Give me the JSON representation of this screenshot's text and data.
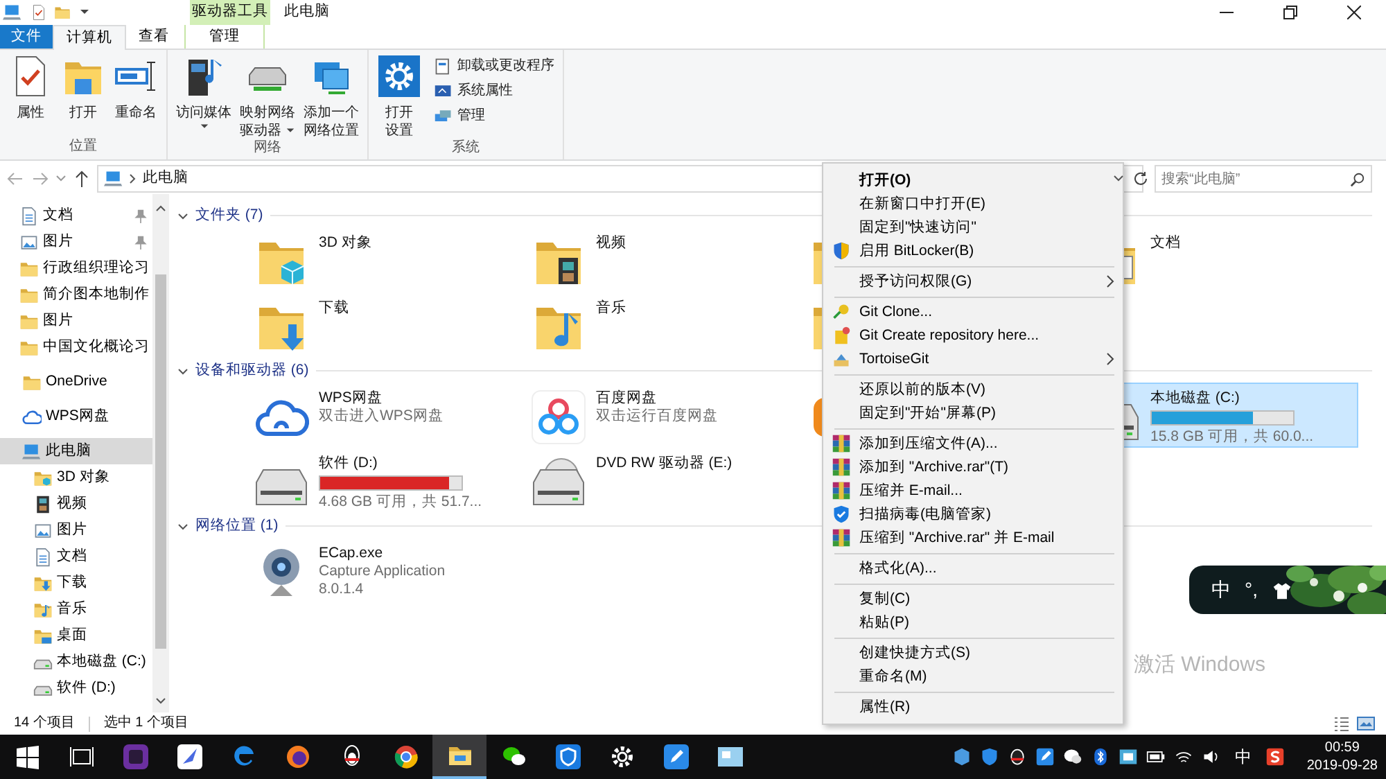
{
  "window": {
    "title": "此电脑",
    "tool_tab": "驱动器工具"
  },
  "ribbon": {
    "tabs": [
      {
        "label": "文件",
        "kind": "file",
        "selected": false
      },
      {
        "label": "计算机",
        "kind": "tab",
        "selected": true
      },
      {
        "label": "查看",
        "kind": "tab",
        "selected": false
      },
      {
        "label": "管理",
        "kind": "tool",
        "selected": false
      }
    ],
    "groups": [
      {
        "label": "位置",
        "buttons": [
          {
            "lines": [
              "属性"
            ],
            "kind": "properties",
            "dropdown": false
          },
          {
            "lines": [
              "打开"
            ],
            "kind": "open",
            "dropdown": false
          },
          {
            "lines": [
              "重命名"
            ],
            "kind": "rename",
            "dropdown": false
          }
        ]
      },
      {
        "label": "网络",
        "buttons": [
          {
            "lines": [
              "访问媒体"
            ],
            "kind": "media",
            "dropdown": true
          },
          {
            "lines": [
              "映射网络",
              "驱动器"
            ],
            "kind": "map-drive",
            "dropdown": true
          },
          {
            "lines": [
              "添加一个",
              "网络位置"
            ],
            "kind": "add-location",
            "dropdown": false
          }
        ]
      },
      {
        "label": "系统",
        "buttons": [
          {
            "lines": [
              "打开",
              "设置"
            ],
            "kind": "settings",
            "dropdown": false
          }
        ],
        "small_buttons": [
          {
            "label": "卸载或更改程序",
            "kind": "uninstall"
          },
          {
            "label": "系统属性",
            "kind": "sys-props"
          },
          {
            "label": "管理",
            "kind": "manage"
          }
        ]
      }
    ]
  },
  "address_bar": {
    "path": "此电脑",
    "search_placeholder": "搜索“此电脑”"
  },
  "navigation": {
    "quick_access": [
      {
        "label": "文档",
        "kind": "doc",
        "pinned": true
      },
      {
        "label": "图片",
        "kind": "picture",
        "pinned": true
      },
      {
        "label": "行政组织理论习",
        "kind": "folder",
        "pinned": false
      },
      {
        "label": "简介图本地制作",
        "kind": "folder",
        "pinned": false
      },
      {
        "label": "图片",
        "kind": "folder",
        "pinned": false
      },
      {
        "label": "中国文化概论习",
        "kind": "folder",
        "pinned": false
      }
    ],
    "items": [
      {
        "label": "OneDrive",
        "kind": "onedrive",
        "selected": false
      },
      {
        "label": "WPS网盘",
        "kind": "cloud",
        "selected": false
      },
      {
        "label": "此电脑",
        "kind": "pc",
        "selected": true,
        "children": [
          {
            "label": "3D 对象",
            "kind": "cube",
            "selected": false
          },
          {
            "label": "视频",
            "kind": "video",
            "selected": false
          },
          {
            "label": "图片",
            "kind": "picture",
            "selected": false
          },
          {
            "label": "文档",
            "kind": "doc",
            "selected": false
          },
          {
            "label": "下载",
            "kind": "download",
            "selected": false
          },
          {
            "label": "音乐",
            "kind": "music",
            "selected": false
          },
          {
            "label": "桌面",
            "kind": "desktop",
            "selected": false
          },
          {
            "label": "本地磁盘 (C:)",
            "kind": "drive",
            "selected": false
          },
          {
            "label": "软件 (D:)",
            "kind": "drive",
            "selected": false
          }
        ]
      }
    ]
  },
  "sections": [
    {
      "title": "文件夹 (7)",
      "expanded": true,
      "items": [
        {
          "label": "3D 对象",
          "kind": "folder-3d",
          "selected": false
        },
        {
          "label": "视频",
          "kind": "folder-video",
          "selected": false
        },
        {
          "kind": "folder",
          "selected": false
        },
        {
          "label": "文档",
          "kind": "folder-doc",
          "selected": false
        },
        {
          "label": "下载",
          "kind": "folder-download",
          "selected": false
        },
        {
          "label": "音乐",
          "kind": "folder-music",
          "selected": false
        },
        {
          "kind": "folder",
          "selected": false
        }
      ]
    },
    {
      "title": "设备和驱动器 (6)",
      "expanded": true,
      "items": [
        {
          "label": "WPS网盘",
          "sub": "双击进入WPS网盘",
          "kind": "wps",
          "selected": false
        },
        {
          "label": "百度网盘",
          "sub": "双击运行百度网盘",
          "kind": "baidu",
          "selected": false
        },
        {
          "kind": "app",
          "selected": false
        },
        {
          "label": "本地磁盘 (C:)",
          "kind": "drive",
          "level": 0.72,
          "detail": "15.8 GB 可用，共 60.0...",
          "selected": true
        },
        {
          "label": "软件 (D:)",
          "kind": "drive",
          "level": 0.91,
          "detail": "4.68 GB 可用，共 51.7...",
          "selected": false
        },
        {
          "label": "DVD RW 驱动器 (E:)",
          "kind": "dvd",
          "selected": false
        }
      ]
    },
    {
      "title": "网络位置 (1)",
      "expanded": true,
      "items": [
        {
          "label": "ECap.exe",
          "sub": "Capture Application",
          "detail": "8.0.1.4",
          "kind": "webcam",
          "selected": false
        }
      ]
    }
  ],
  "status_bar": {
    "item_count": "14 个项目",
    "selection": "选中 1 个项目"
  },
  "context_menu": {
    "groups": [
      [
        {
          "label": "打开(O)",
          "kind": "plain",
          "default": true,
          "submenu": false
        },
        {
          "label": "在新窗口中打开(E)",
          "kind": "plain",
          "default": false,
          "submenu": false
        },
        {
          "label": "固定到\"快速访问\"",
          "kind": "plain",
          "default": false,
          "submenu": false
        },
        {
          "label": "启用 BitLocker(B)",
          "kind": "shield",
          "default": false,
          "submenu": false
        }
      ],
      [
        {
          "label": "授予访问权限(G)",
          "kind": "plain",
          "default": false,
          "submenu": true
        }
      ],
      [
        {
          "label": "Git Clone...",
          "kind": "git-clone",
          "default": false,
          "submenu": false
        },
        {
          "label": "Git Create repository here...",
          "kind": "git-repo",
          "default": false,
          "submenu": false
        },
        {
          "label": "TortoiseGit",
          "kind": "tortoise",
          "default": false,
          "submenu": true
        }
      ],
      [
        {
          "label": "还原以前的版本(V)",
          "kind": "plain",
          "default": false,
          "submenu": false
        },
        {
          "label": "固定到\"开始\"屏幕(P)",
          "kind": "plain",
          "default": false,
          "submenu": false
        }
      ],
      [
        {
          "label": "添加到压缩文件(A)...",
          "kind": "rar",
          "default": false,
          "submenu": false
        },
        {
          "label": "添加到 \"Archive.rar\"(T)",
          "kind": "rar",
          "default": false,
          "submenu": false
        },
        {
          "label": "压缩并 E-mail...",
          "kind": "rar",
          "default": false,
          "submenu": false
        },
        {
          "label": "扫描病毒(电脑管家)",
          "kind": "guard",
          "default": false,
          "submenu": false
        },
        {
          "label": "压缩到 \"Archive.rar\" 并 E-mail",
          "kind": "rar",
          "default": false,
          "submenu": false
        }
      ],
      [
        {
          "label": "格式化(A)...",
          "kind": "plain",
          "default": false,
          "submenu": false
        }
      ],
      [
        {
          "label": "复制(C)",
          "kind": "plain",
          "default": false,
          "submenu": false
        },
        {
          "label": "粘贴(P)",
          "kind": "plain",
          "default": false,
          "submenu": false
        }
      ],
      [
        {
          "label": "创建快捷方式(S)",
          "kind": "plain",
          "default": false,
          "submenu": false
        },
        {
          "label": "重命名(M)",
          "kind": "plain",
          "default": false,
          "submenu": false
        }
      ],
      [
        {
          "label": "属性(R)",
          "kind": "plain",
          "default": false,
          "submenu": false
        }
      ]
    ]
  },
  "ime_bar": {
    "mode": "中",
    "punctuation": "°,"
  },
  "activation_notice": "激活 Windows",
  "taskbar": {
    "apps": [
      {
        "kind": "start",
        "selected": false
      },
      {
        "kind": "taskview",
        "selected": false
      },
      {
        "kind": "ps",
        "selected": false
      },
      {
        "kind": "feather",
        "selected": false
      },
      {
        "kind": "edge",
        "selected": false
      },
      {
        "kind": "firefox",
        "selected": false
      },
      {
        "kind": "qq",
        "selected": false
      },
      {
        "kind": "chrome",
        "selected": false
      },
      {
        "kind": "explorer",
        "selected": true
      },
      {
        "kind": "wechat",
        "selected": false
      },
      {
        "kind": "guard",
        "selected": false
      },
      {
        "kind": "settings",
        "selected": false
      },
      {
        "kind": "note",
        "selected": false
      },
      {
        "kind": "capture",
        "selected": false
      }
    ],
    "tray": [
      {
        "kind": "cube"
      },
      {
        "kind": "shield"
      },
      {
        "kind": "penguin"
      },
      {
        "kind": "note"
      },
      {
        "kind": "chat"
      },
      {
        "kind": "bluetooth"
      },
      {
        "kind": "remote"
      },
      {
        "kind": "battery"
      },
      {
        "kind": "wifi"
      },
      {
        "kind": "volume"
      },
      {
        "kind": "text",
        "label": "中"
      },
      {
        "kind": "sogou"
      }
    ],
    "clock": "00:59",
    "date": "2019-09-28"
  }
}
